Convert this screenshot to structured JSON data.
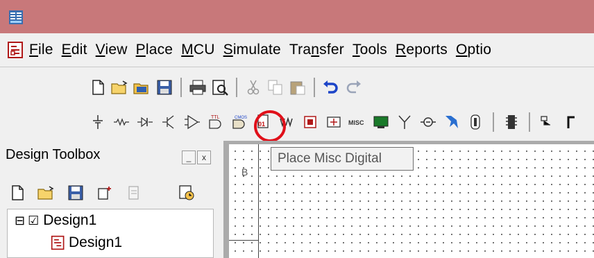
{
  "menu": {
    "items": [
      {
        "pre": "",
        "ul": "F",
        "post": "ile"
      },
      {
        "pre": "",
        "ul": "E",
        "post": "dit"
      },
      {
        "pre": "",
        "ul": "V",
        "post": "iew"
      },
      {
        "pre": "",
        "ul": "P",
        "post": "lace"
      },
      {
        "pre": "",
        "ul": "M",
        "post": "CU"
      },
      {
        "pre": "",
        "ul": "S",
        "post": "imulate"
      },
      {
        "pre": "Tra",
        "ul": "n",
        "post": "sfer"
      },
      {
        "pre": "",
        "ul": "T",
        "post": "ools"
      },
      {
        "pre": "",
        "ul": "R",
        "post": "eports"
      },
      {
        "pre": "",
        "ul": "O",
        "post": "ptio"
      }
    ]
  },
  "toolbox": {
    "title": "Design Toolbox",
    "minimize": "_",
    "close": "x",
    "tree": {
      "root_expander": "⊟",
      "root_label": "Design1",
      "child_label": "Design1"
    }
  },
  "canvas": {
    "sheet_letter": "B"
  },
  "tooltip": {
    "text": "Place Misc Digital"
  },
  "component_toolbar": {
    "misc_label": "MISC",
    "ttl_label": "TTL",
    "cmos_label": "CMOS"
  },
  "colors": {
    "titlebar": "#c8787a",
    "highlight_circle": "#e0101a",
    "toolbar_bg": "#f0f0f0"
  }
}
